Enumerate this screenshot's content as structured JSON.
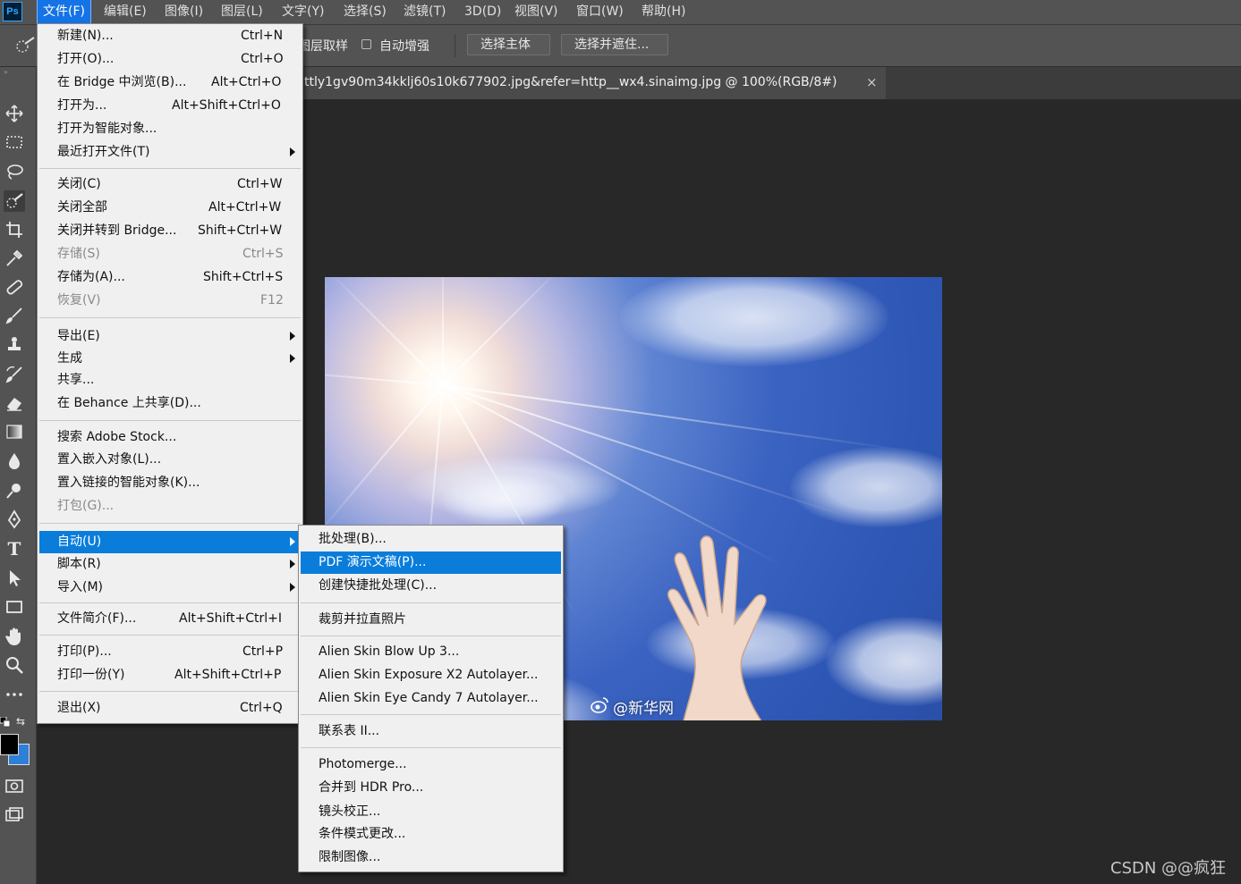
{
  "app": {
    "logo_text": "Ps"
  },
  "menubar": {
    "items": [
      {
        "label": "文件(F)"
      },
      {
        "label": "编辑(E)"
      },
      {
        "label": "图像(I)"
      },
      {
        "label": "图层(L)"
      },
      {
        "label": "文字(Y)"
      },
      {
        "label": "选择(S)"
      },
      {
        "label": "滤镜(T)"
      },
      {
        "label": "3D(D)"
      },
      {
        "label": "视图(V)"
      },
      {
        "label": "窗口(W)"
      },
      {
        "label": "帮助(H)"
      }
    ]
  },
  "options": {
    "sample_all_layers": "图层取样",
    "auto_enhance": "自动增强",
    "select_subject": "选择主体",
    "select_and_mask": "选择并遮住..."
  },
  "document": {
    "tab_title": "ttly1gv90m34kklj60s10k677902.jpg&refer=http__wx4.sinaimg.jpg @ 100%(RGB/8#)",
    "close": "×",
    "image_watermark": "@新华网"
  },
  "file_menu": {
    "items": [
      {
        "label": "新建(N)...",
        "shortcut": "Ctrl+N"
      },
      {
        "label": "打开(O)...",
        "shortcut": "Ctrl+O"
      },
      {
        "label": "在 Bridge 中浏览(B)...",
        "shortcut": "Alt+Ctrl+O"
      },
      {
        "label": "打开为...",
        "shortcut": "Alt+Shift+Ctrl+O"
      },
      {
        "label": "打开为智能对象...",
        "shortcut": ""
      },
      {
        "label": "最近打开文件(T)",
        "shortcut": ""
      },
      {
        "label": "关闭(C)",
        "shortcut": "Ctrl+W"
      },
      {
        "label": "关闭全部",
        "shortcut": "Alt+Ctrl+W"
      },
      {
        "label": "关闭并转到 Bridge...",
        "shortcut": "Shift+Ctrl+W"
      },
      {
        "label": "存储(S)",
        "shortcut": "Ctrl+S"
      },
      {
        "label": "存储为(A)...",
        "shortcut": "Shift+Ctrl+S"
      },
      {
        "label": "恢复(V)",
        "shortcut": "F12"
      },
      {
        "label": "导出(E)",
        "shortcut": ""
      },
      {
        "label": "生成",
        "shortcut": ""
      },
      {
        "label": "共享...",
        "shortcut": ""
      },
      {
        "label": "在 Behance 上共享(D)...",
        "shortcut": ""
      },
      {
        "label": "搜索 Adobe Stock...",
        "shortcut": ""
      },
      {
        "label": "置入嵌入对象(L)...",
        "shortcut": ""
      },
      {
        "label": "置入链接的智能对象(K)...",
        "shortcut": ""
      },
      {
        "label": "打包(G)...",
        "shortcut": ""
      },
      {
        "label": "自动(U)",
        "shortcut": ""
      },
      {
        "label": "脚本(R)",
        "shortcut": ""
      },
      {
        "label": "导入(M)",
        "shortcut": ""
      },
      {
        "label": "文件简介(F)...",
        "shortcut": "Alt+Shift+Ctrl+I"
      },
      {
        "label": "打印(P)...",
        "shortcut": "Ctrl+P"
      },
      {
        "label": "打印一份(Y)",
        "shortcut": "Alt+Shift+Ctrl+P"
      },
      {
        "label": "退出(X)",
        "shortcut": "Ctrl+Q"
      }
    ]
  },
  "automate_submenu": {
    "items": [
      {
        "label": "批处理(B)..."
      },
      {
        "label": "PDF 演示文稿(P)..."
      },
      {
        "label": "创建快捷批处理(C)..."
      },
      {
        "label": "裁剪并拉直照片"
      },
      {
        "label": "Alien Skin Blow Up 3..."
      },
      {
        "label": "Alien Skin Exposure X2 Autolayer..."
      },
      {
        "label": "Alien Skin Eye Candy 7 Autolayer..."
      },
      {
        "label": "联系表 II..."
      },
      {
        "label": "Photomerge..."
      },
      {
        "label": "合并到 HDR Pro..."
      },
      {
        "label": "镜头校正..."
      },
      {
        "label": "条件模式更改..."
      },
      {
        "label": "限制图像..."
      }
    ]
  },
  "watermark": "CSDN @@疯狂",
  "colors": {
    "accent": "#0a7ddb",
    "menubar": "#535353",
    "canvas": "#282828",
    "menu_bg": "#f0f0f0",
    "foreground": "#000000",
    "background": "#2e7fd8"
  }
}
